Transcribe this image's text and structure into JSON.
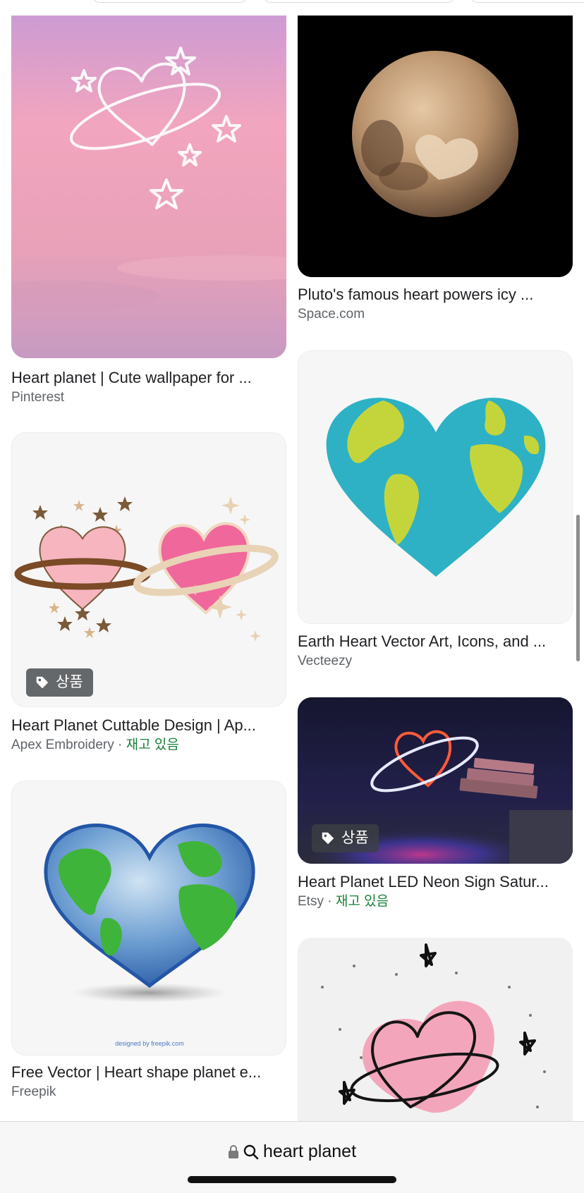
{
  "search": {
    "query": "heart planet"
  },
  "badge_label": "상품",
  "results": [
    {
      "title": "Heart planet | Cute wallpaper for ...",
      "source": "Pinterest",
      "stock": ""
    },
    {
      "title": "Pluto's famous heart powers icy ...",
      "source": "Space.com",
      "stock": ""
    },
    {
      "title": "Heart Planet Cuttable Design | Ap...",
      "source": "Apex Embroidery",
      "stock": "재고 있음"
    },
    {
      "title": "Earth Heart Vector Art, Icons, and ...",
      "source": "Vecteezy",
      "stock": ""
    },
    {
      "title": "Heart Planet LED Neon Sign Satur...",
      "source": "Etsy",
      "stock": "재고 있음"
    },
    {
      "title": "Free Vector | Heart shape planet e...",
      "source": "Freepik",
      "stock": ""
    }
  ],
  "watermark": "designed by freepik.com",
  "colors": {
    "in_stock": "#188038",
    "source_gray": "#5f6368"
  }
}
